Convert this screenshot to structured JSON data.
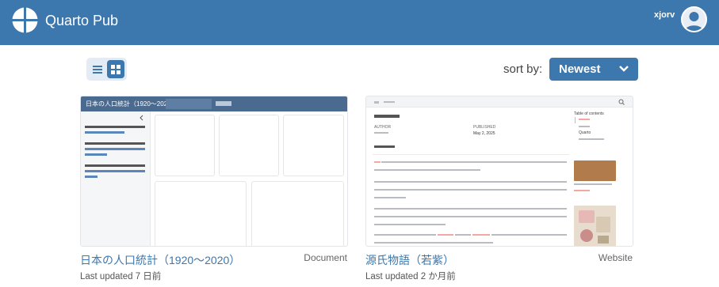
{
  "header": {
    "brand": "Quarto Pub",
    "username": "xjorv",
    "logo_icon": "quarto-logo-icon",
    "avatar_icon": "user-avatar-icon"
  },
  "toolbar": {
    "view_list_icon": "list-view-icon",
    "view_grid_icon": "grid-view-icon",
    "sort_label": "sort by:",
    "sort_value": "Newest",
    "sort_chevron_icon": "chevron-down-icon"
  },
  "colors": {
    "header": "#3c77ad",
    "accent": "#3c77ad",
    "toggle_bg": "#e3ecf6"
  },
  "cards": [
    {
      "title": "日本の人口統計（1920〜2020）",
      "type": "Document",
      "updated": "Last updated 7 日前"
    },
    {
      "title": "源氏物語（若紫）",
      "type": "Website",
      "updated": "Last updated 2 か月前"
    }
  ],
  "thumb1": {
    "nav_title": "日本の人口統計（1920〜2020）"
  },
  "thumb2": {
    "toc_title": "Table of contents",
    "author_label": "AUTHOR",
    "published_label": "PUBLISHED",
    "published_value": "May 2, 2025",
    "quarto_label": "Quarto"
  }
}
